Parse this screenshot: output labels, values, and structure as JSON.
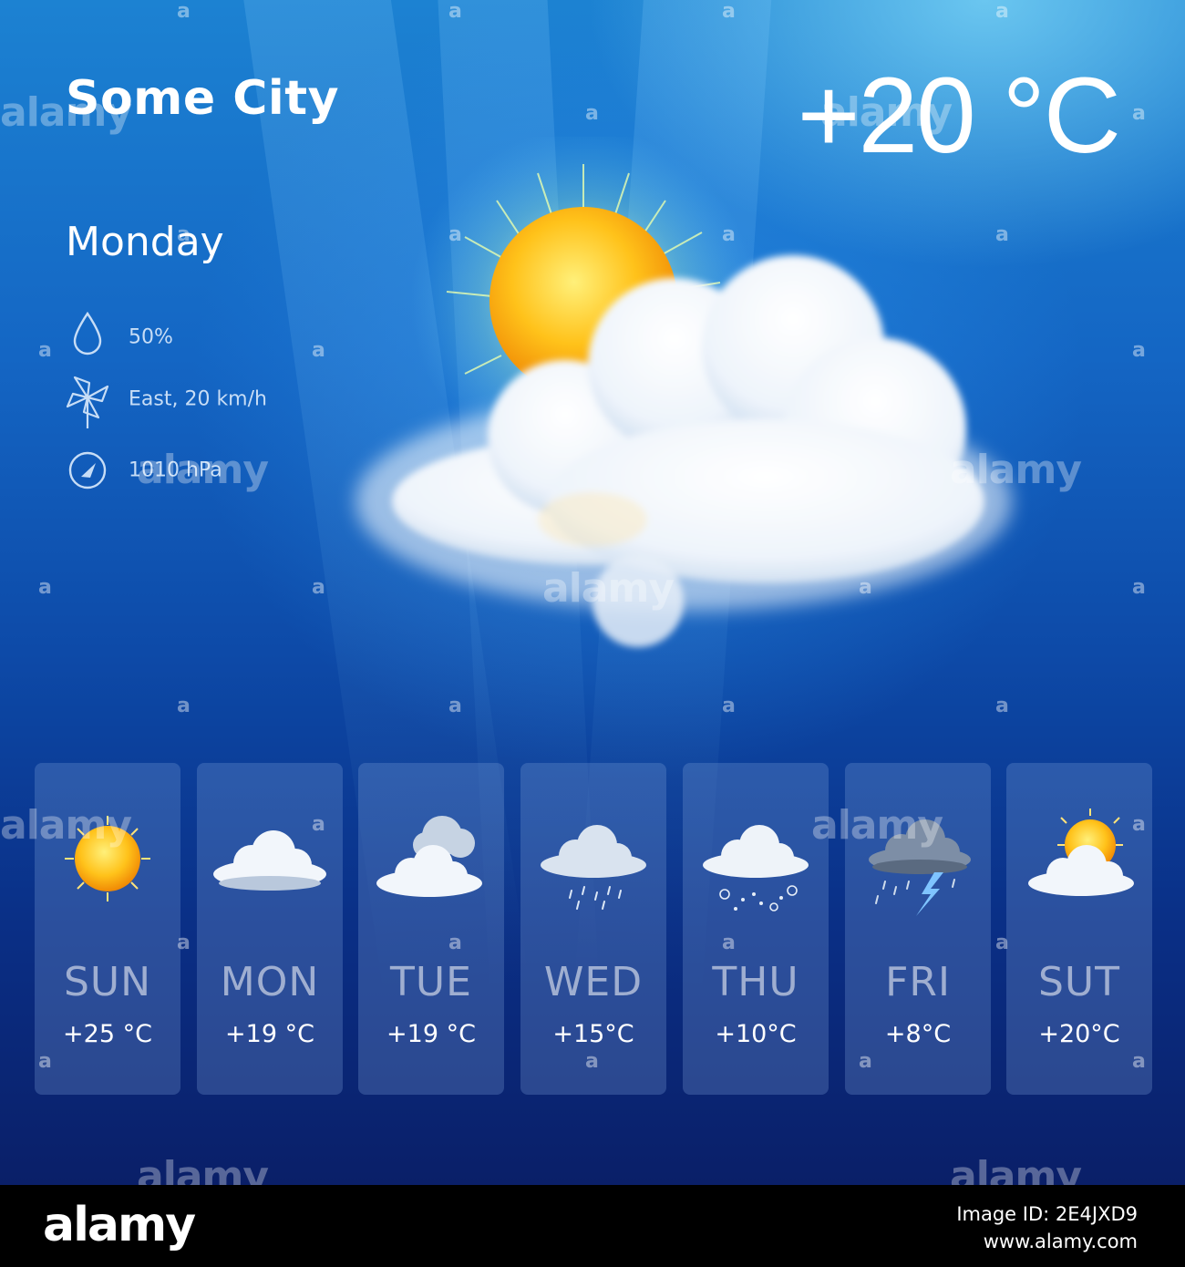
{
  "location": {
    "city": "Some City"
  },
  "current": {
    "temperature": "+20 °C",
    "day": "Monday",
    "condition_icon": "sun-behind-cloud-icon",
    "details": [
      {
        "icon": "humidity-drop-icon",
        "text": "50%"
      },
      {
        "icon": "wind-pinwheel-icon",
        "text": "East, 20 km/h"
      },
      {
        "icon": "pressure-gauge-icon",
        "text": "1010 hPa"
      }
    ]
  },
  "forecast": [
    {
      "day": "SUN",
      "temp": "+25 °C",
      "icon": "sunny-icon"
    },
    {
      "day": "MON",
      "temp": "+19 °C",
      "icon": "cloudy-icon"
    },
    {
      "day": "TUE",
      "temp": "+19 °C",
      "icon": "overcast-icon"
    },
    {
      "day": "WED",
      "temp": "+15°C",
      "icon": "rain-icon"
    },
    {
      "day": "THU",
      "temp": "+10°C",
      "icon": "snow-rain-icon"
    },
    {
      "day": "FRI",
      "temp": "+8°C",
      "icon": "thunderstorm-icon"
    },
    {
      "day": "SUT",
      "temp": "+20°C",
      "icon": "partly-cloudy-icon"
    }
  ],
  "watermark": {
    "text": "alamy",
    "mark": "a",
    "footer_brand": "alamy",
    "image_id": "Image ID: 2E4JXD9",
    "site": "www.alamy.com"
  },
  "colors": {
    "sky_top": "#1c82d2",
    "sky_bottom": "#0a1f68",
    "sun": "#ffc21a",
    "detail_text": "#c7ddf6",
    "card_bg": "rgba(130,165,220,0.28)"
  }
}
